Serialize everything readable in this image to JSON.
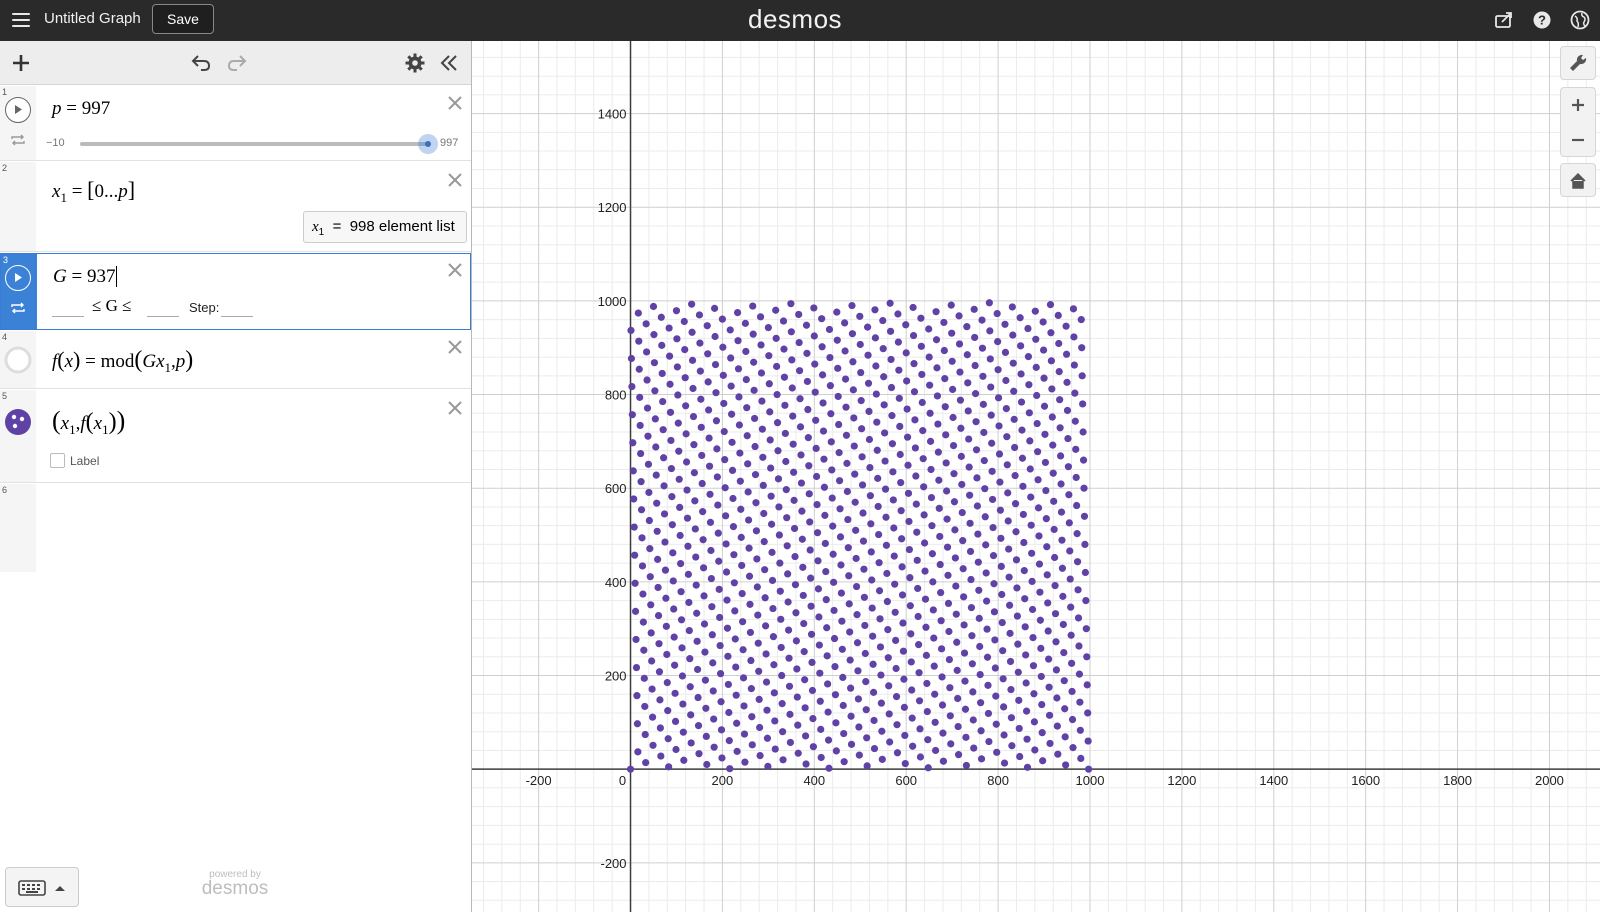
{
  "topbar": {
    "title": "Untitled Graph",
    "save_label": "Save",
    "brand": "desmos"
  },
  "expressions": [
    {
      "index": "1",
      "type": "slider",
      "var": "p",
      "value": "997",
      "slider_min": "−10",
      "slider_max": "997",
      "slider_position": 1.0
    },
    {
      "index": "2",
      "type": "list",
      "latex": "x_1 = [0...p]",
      "eval_var": "x",
      "eval_sub": "1",
      "eval_eq": "=",
      "eval_text": "998 element list"
    },
    {
      "index": "3",
      "type": "slider",
      "var": "G",
      "value": "937",
      "limits_op": "≤ G ≤",
      "step_label": "Step:",
      "selected": true
    },
    {
      "index": "4",
      "type": "function",
      "latex": "f(x) = mod(G x_1, p)"
    },
    {
      "index": "5",
      "type": "points",
      "latex": "(x_1, f(x_1))",
      "label_text": "Label",
      "label_checked": false,
      "color": "#6042a6"
    },
    {
      "index": "6",
      "type": "empty"
    }
  ],
  "powered": {
    "by": "powered by",
    "name": "desmos"
  },
  "graph": {
    "point_color": "#6042a6",
    "x_ticks": [
      "-200",
      "0",
      "200",
      "400",
      "600",
      "800",
      "1000",
      "1200",
      "1400",
      "1600",
      "1800",
      "2000"
    ],
    "y_ticks": [
      "1400",
      "1200",
      "1000",
      "800",
      "600",
      "400",
      "200",
      "-200"
    ]
  },
  "chart_data": {
    "type": "scatter",
    "expression": "(x_1, mod(G x_1, p))",
    "p": 997,
    "G": 937,
    "x_range": [
      0,
      997
    ],
    "xlim": [
      -345,
      2110
    ],
    "ylim": [
      -305,
      1555
    ],
    "grid": true,
    "point_count": 998
  },
  "colors": {
    "topbar_bg": "#2a2a2a",
    "selected_accent": "#3b82d6",
    "points": "#6042a6"
  }
}
